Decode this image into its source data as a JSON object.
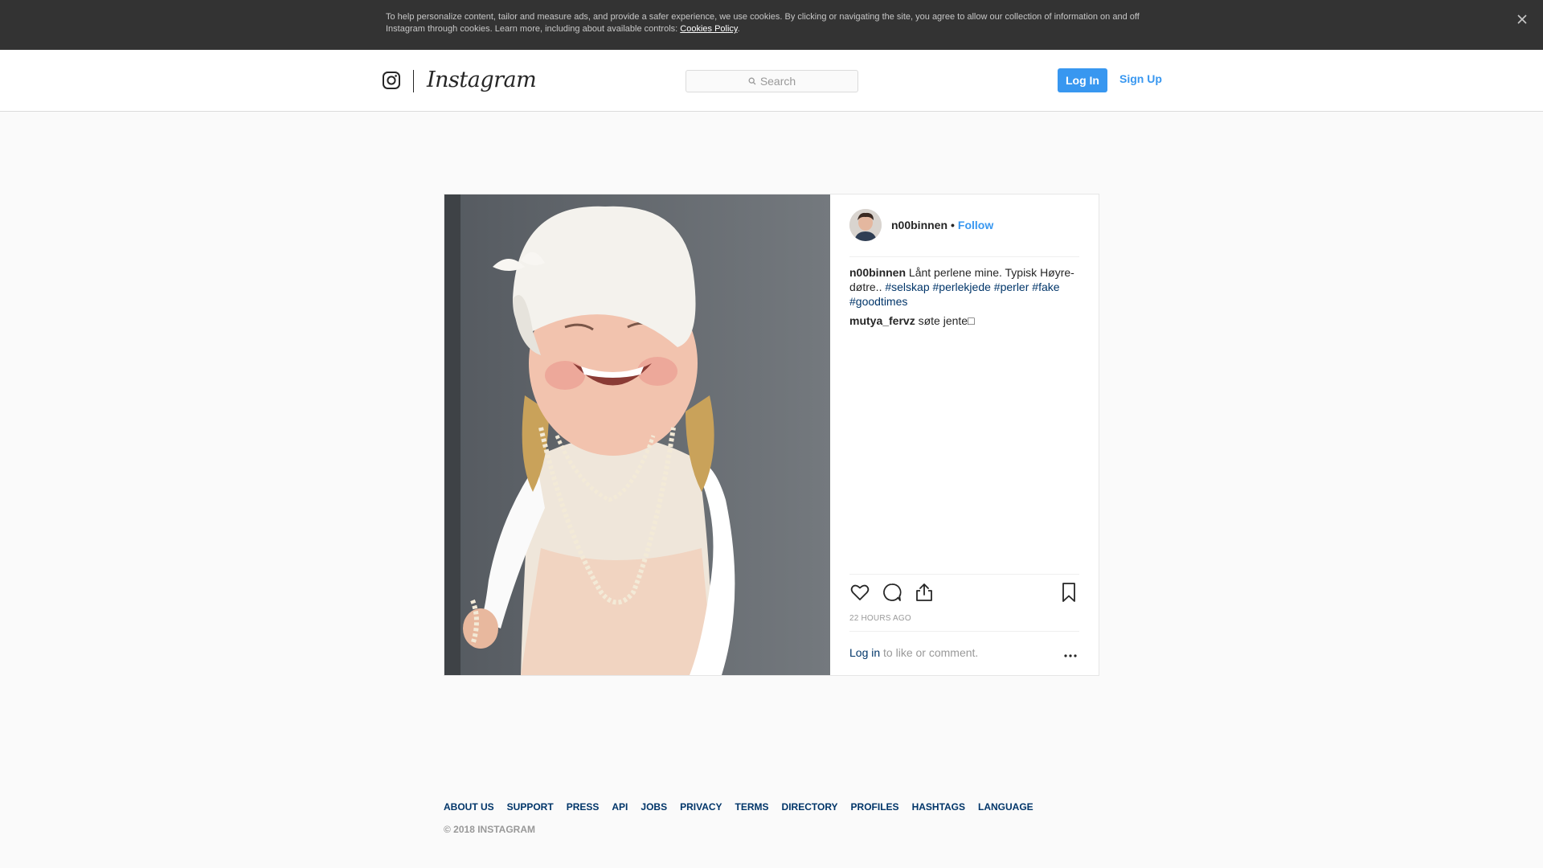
{
  "cookie_banner": {
    "text": "To help personalize content, tailor and measure ads, and provide a safer experience, we use cookies. By clicking or navigating the site, you agree to allow our collection of information on and off Instagram through cookies. Learn more, including about available controls: ",
    "link": "Cookies Policy",
    "link_suffix": ".",
    "close_icon": "close-icon"
  },
  "header": {
    "logo_icon": "instagram-glyph-icon",
    "wordmark": "Instagram",
    "search_placeholder": "Search",
    "login_label": "Log In",
    "signup_label": "Sign Up"
  },
  "post": {
    "author": "n00binnen",
    "separator": "•",
    "follow_label": "Follow",
    "caption": {
      "user": "n00binnen",
      "text": "Lånt perlene mine. Typisk Høyre-døtre..",
      "tags": [
        "#selskap",
        "#perlekjede",
        "#perler",
        "#fake",
        "#goodtimes"
      ]
    },
    "comments": [
      {
        "user": "mutya_fervz",
        "text": "søte jente□"
      }
    ],
    "actions": [
      "heart-icon",
      "comment-icon",
      "share-icon",
      "bookmark-icon"
    ],
    "timestamp": "22 HOURS AGO",
    "login_prompt": {
      "link": "Log in",
      "text": " to like or comment."
    },
    "more_icon": "more-options-icon"
  },
  "footer": {
    "links": [
      "ABOUT US",
      "SUPPORT",
      "PRESS",
      "API",
      "JOBS",
      "PRIVACY",
      "TERMS",
      "DIRECTORY",
      "PROFILES",
      "HASHTAGS",
      "LANGUAGE"
    ],
    "copyright": "© 2018 INSTAGRAM"
  },
  "colors": {
    "accent": "#3897f0",
    "link_dark": "#003569",
    "banner_bg": "#333333"
  }
}
